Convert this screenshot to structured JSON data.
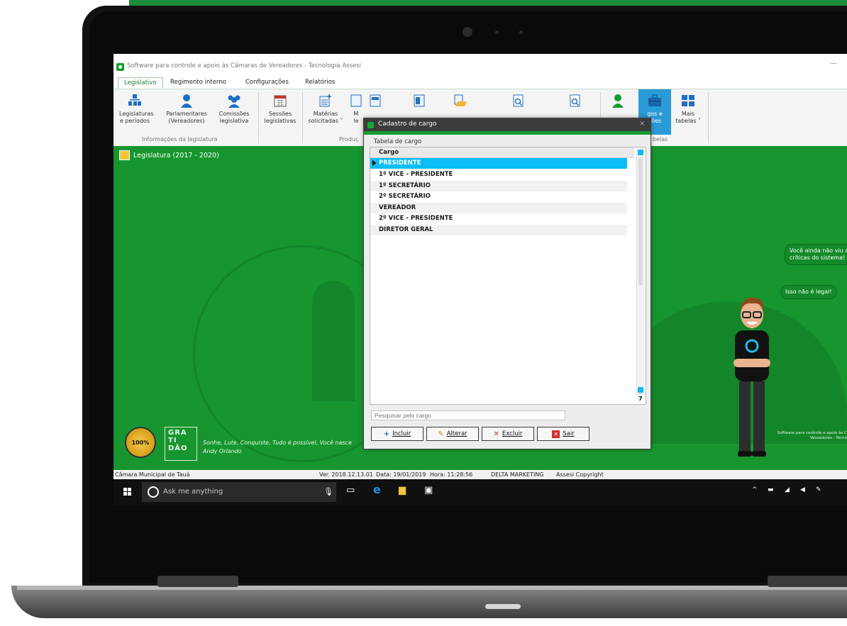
{
  "colors": {
    "desktop_green": "#17962f",
    "selection_blue": "#0bbdf3",
    "dialog_title": "#3c3c3c"
  },
  "app": {
    "title": "Software para controle e apoio às Câmaras de Vereadores - Tecnologia Assesi",
    "window_min_symbol": "—"
  },
  "tabs": [
    "Legislativo",
    "Regimento interno",
    "Configurações",
    "Relatórios"
  ],
  "ribbon": {
    "buttons": [
      {
        "label": "Legislaturas\ne períodos",
        "icon": "hierarchy-icon"
      },
      {
        "label": "Parlamentares\n(Vereadores)",
        "icon": "person-icon"
      },
      {
        "label": "Comissões\nlegislativa",
        "icon": "group-icon"
      },
      {
        "label": "Sessões\nlegislativas",
        "icon": "calendar-icon"
      },
      {
        "label": "Matérias\nsolicitadas ˅",
        "icon": "document-add-icon"
      },
      {
        "label": "M\nle",
        "icon": "document-icon"
      },
      {
        "label": "",
        "icon": "document-icon"
      },
      {
        "label": "",
        "icon": "document-icon"
      },
      {
        "label": "",
        "icon": "folder-document-icon"
      },
      {
        "label": "",
        "icon": "search-document-icon"
      },
      {
        "label": "",
        "icon": "search-document-icon"
      },
      {
        "label": "",
        "icon": "person-icon"
      },
      {
        "label": "gos e\nções",
        "icon": "briefcase-icon"
      },
      {
        "label": "Mais\ntabelas ˅",
        "icon": "tables-icon"
      }
    ],
    "groups": [
      "Informações da legislatura",
      "Produç",
      "belas"
    ]
  },
  "desktop": {
    "legislatura_label": "Legislatura (2017 - 2020)",
    "bubble_1": "Você ainda não viu a\ncríticas do sistema!",
    "bubble_2": "Isso não é legal!",
    "footer_small": "Software para controle e apoio às C\nVereadores - Tecno",
    "seal_text": "100%",
    "gratidao": "GRA\nTI\nDÃO",
    "quote": "Sonhe, Lute, Conquiste, Tudo é possível, Você nasce",
    "quote_author": "Andy Orlando"
  },
  "statusbar": {
    "entity": "Câmara Municipal de Tauá",
    "version": "Ver. 2018.12.13.01",
    "date": "Data: 19/01/2019",
    "time": "Hora: 11:28:56",
    "company": "DELTA MARKETING",
    "copyright": "Assesi Copyright"
  },
  "taskbar": {
    "search_placeholder": "Ask me anything"
  },
  "dialog": {
    "title": "Cadastro de cargo",
    "close_symbol": "×",
    "fieldset_label": "Tabela de cargo",
    "column_header": "Cargo",
    "rows": [
      "PRESIDENTE",
      "1º VICE - PRESIDENTE",
      "1º SECRETÁRIO",
      "2º SECRETÁRIO",
      "VEREADOR",
      "2º VICE - PRESIDENTE",
      "DIRETOR GERAL"
    ],
    "selected_row": 0,
    "record_count": "7",
    "search_placeholder": "Pesquisar pelo cargo",
    "buttons": {
      "incluir": "Incluir",
      "alterar": "Alterar",
      "excluir": "Excluir",
      "sair": "Sair"
    }
  }
}
